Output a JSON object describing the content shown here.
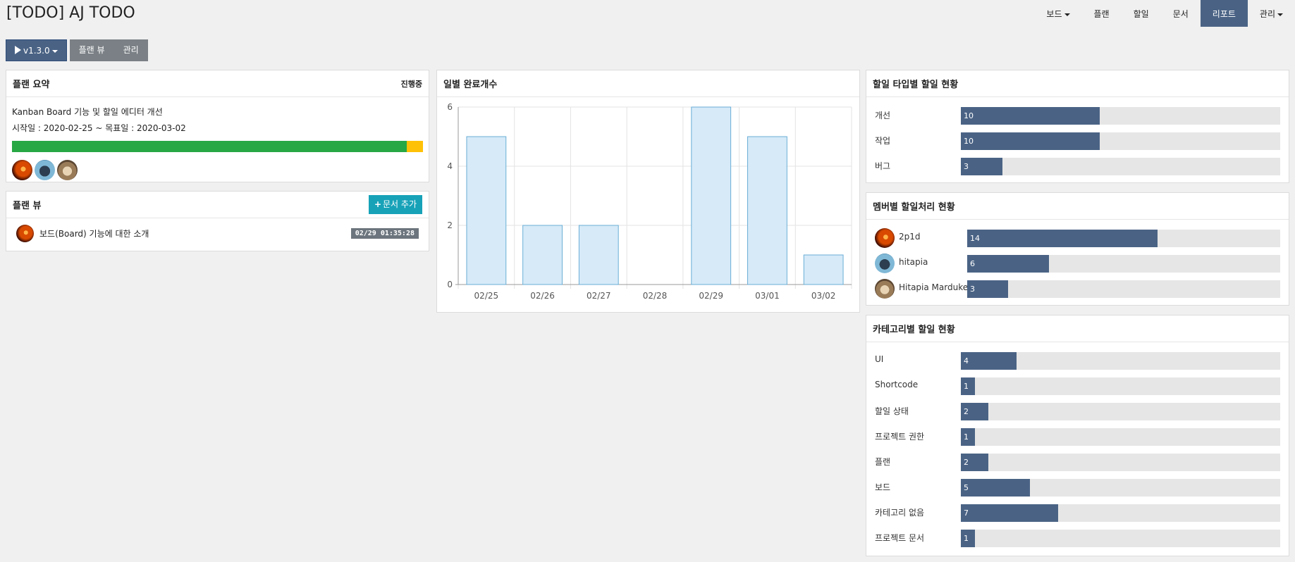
{
  "app": {
    "title": "[TODO] AJ TODO"
  },
  "nav": [
    {
      "label": "보드",
      "dropdown": true
    },
    {
      "label": "플랜",
      "dropdown": false
    },
    {
      "label": "할일",
      "dropdown": false
    },
    {
      "label": "문서",
      "dropdown": false
    },
    {
      "label": "리포트",
      "dropdown": false,
      "active": true
    },
    {
      "label": "관리",
      "dropdown": true
    }
  ],
  "toolbar": {
    "version": "v1.3.0",
    "plan_view": "플랜 뷰",
    "manage": "관리"
  },
  "summary": {
    "title": "플랜 요약",
    "status": "진행중",
    "plan_name": "Kanban Board 기능 및 할일 에디터 개선",
    "dates": "시작일 : 2020-02-25 ~ 목표일 : 2020-03-02",
    "progress": 0.96,
    "members": [
      "fire-avatar",
      "batman-avatar",
      "dog-avatar"
    ]
  },
  "planview": {
    "title": "플랜 뷰",
    "add_button": "문서 추가",
    "docs": [
      {
        "title": "보드(Board) 기능에 대한 소개",
        "time": "02/29 01:35:28",
        "avatar": "fire-avatar"
      }
    ]
  },
  "daily": {
    "title": "일별 완료개수"
  },
  "chart_data": {
    "type": "bar",
    "categories": [
      "02/25",
      "02/26",
      "02/27",
      "02/28",
      "02/29",
      "03/01",
      "03/02"
    ],
    "values": [
      5,
      2,
      2,
      0,
      6,
      5,
      1
    ],
    "ylim": [
      0,
      6
    ],
    "yticks": [
      0,
      2,
      4,
      6
    ],
    "grid": true,
    "colors": {
      "fill": "#d6eaf8",
      "stroke": "#6aaed6"
    }
  },
  "type_stats": {
    "title": "할일 타입별 할일 현황",
    "max": 23,
    "items": [
      {
        "label": "개선",
        "value": 10
      },
      {
        "label": "작업",
        "value": 10
      },
      {
        "label": "버그",
        "value": 3
      }
    ]
  },
  "member_stats": {
    "title": "멤버별 할일처리 현황",
    "max": 23,
    "items": [
      {
        "label": "2p1d",
        "value": 14,
        "avatar": "fire-avatar"
      },
      {
        "label": "hitapia",
        "value": 6,
        "avatar": "batman-avatar"
      },
      {
        "label": "Hitapia Marduke",
        "value": 3,
        "avatar": "dog-avatar"
      }
    ]
  },
  "category_stats": {
    "title": "카테고리별 할일 현황",
    "max": 23,
    "items": [
      {
        "label": "UI",
        "value": 4
      },
      {
        "label": "Shortcode",
        "value": 1
      },
      {
        "label": "할일 상태",
        "value": 2
      },
      {
        "label": "프로젝트 권한",
        "value": 1
      },
      {
        "label": "플랜",
        "value": 2
      },
      {
        "label": "보드",
        "value": 5
      },
      {
        "label": "카테고리 없음",
        "value": 7
      },
      {
        "label": "프로젝트 문서",
        "value": 1
      }
    ]
  },
  "colors": {
    "accent": "#4a6385",
    "success": "#28a745",
    "warning": "#ffc107",
    "info": "#17a2b8"
  }
}
